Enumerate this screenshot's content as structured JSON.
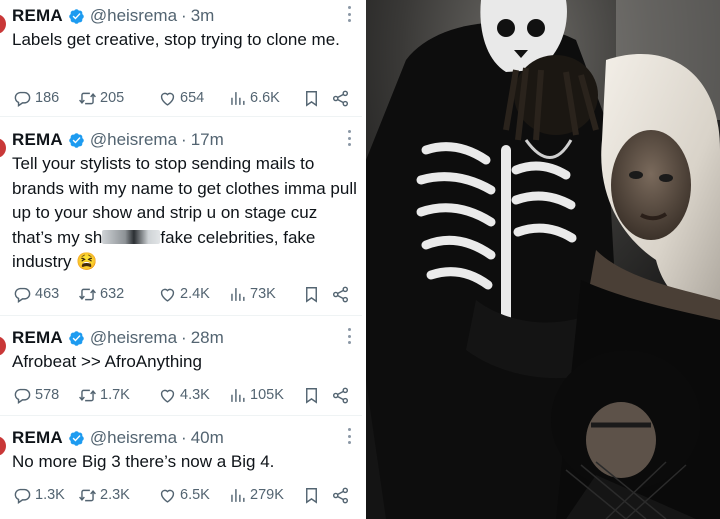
{
  "tweets": [
    {
      "name": "REMA",
      "handle": "@heisrema",
      "time": "3m",
      "text": "Labels get creative, stop trying to clone me.",
      "replies": "186",
      "retweets": "205",
      "likes": "654",
      "views": "6.6K"
    },
    {
      "name": "REMA",
      "handle": "@heisrema",
      "time": "17m",
      "text_before": "Tell your stylists to stop sending mails to brands with my name to get clothes imma pull up to your show and strip u on stage cuz that’s my sh",
      "text_after": "fake celebrities, fake industry 😫",
      "replies": "463",
      "retweets": "632",
      "likes": "2.4K",
      "views": "73K"
    },
    {
      "name": "REMA",
      "handle": "@heisrema",
      "time": "28m",
      "text": "Afrobeat >> AfroAnything",
      "replies": "578",
      "retweets": "1.7K",
      "likes": "4.3K",
      "views": "105K"
    },
    {
      "name": "REMA",
      "handle": "@heisrema",
      "time": "40m",
      "text": "No more Big 3 there’s now a Big 4.",
      "replies": "1.3K",
      "retweets": "2.3K",
      "likes": "6.5K",
      "views": "279K"
    }
  ],
  "separator": "·",
  "icons": [
    "verified-badge-icon",
    "reply-icon",
    "retweet-icon",
    "like-icon",
    "views-icon",
    "bookmark-icon",
    "share-icon",
    "more-icon"
  ],
  "colors": {
    "verified": "#1d9bf0",
    "muted": "#536471",
    "text": "#0f1419"
  }
}
